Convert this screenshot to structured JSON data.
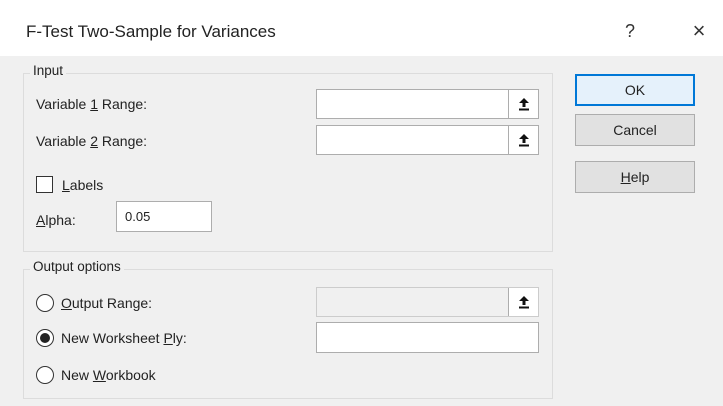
{
  "dialog": {
    "title": "F-Test Two-Sample for Variances",
    "help_glyph": "?",
    "close_glyph": "×"
  },
  "input_group": {
    "legend": "Input",
    "var1_label_pre": "Variable ",
    "var1_label_key": "1",
    "var1_label_post": " Range:",
    "var1_value": "",
    "var2_label_pre": "Variable ",
    "var2_label_key": "2",
    "var2_label_post": " Range:",
    "var2_value": "",
    "labels_key": "L",
    "labels_rest": "abels",
    "labels_checked": false,
    "alpha_key": "A",
    "alpha_rest": "lpha:",
    "alpha_value": "0.05"
  },
  "output_group": {
    "legend": "Output options",
    "output_range_key": "O",
    "output_range_rest": "utput Range:",
    "output_range_value": "",
    "new_ws_pre": "New Worksheet ",
    "new_ws_key": "P",
    "new_ws_post": "ly:",
    "new_ws_value": "",
    "new_wb_pre": "New ",
    "new_wb_key": "W",
    "new_wb_post": "orkbook",
    "selected": "new_worksheet"
  },
  "buttons": {
    "ok": "OK",
    "cancel": "Cancel",
    "help_key": "H",
    "help_rest": "elp"
  },
  "icons": {
    "ref": "range-select-icon"
  }
}
